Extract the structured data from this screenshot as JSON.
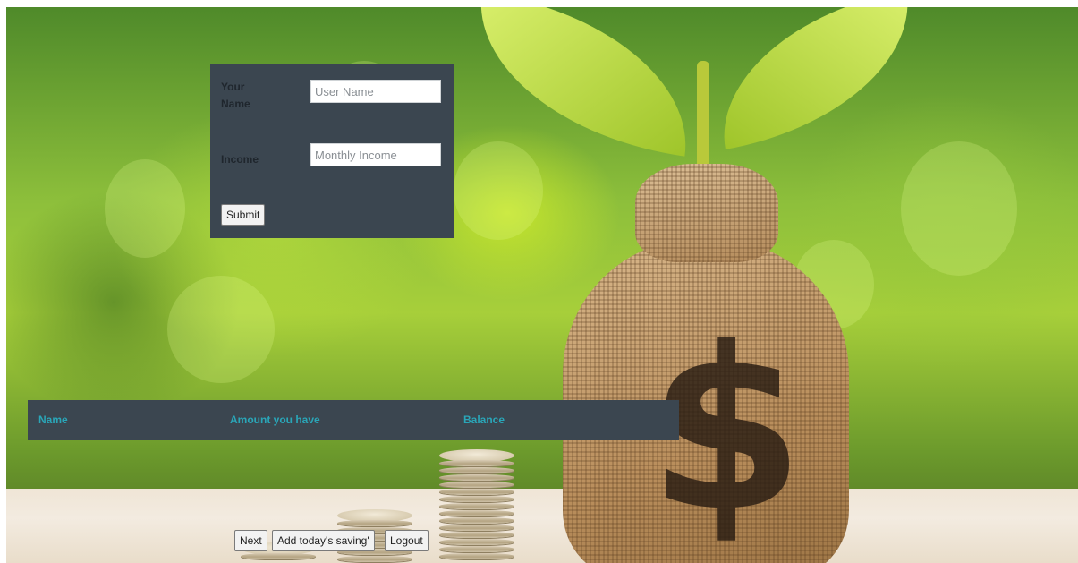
{
  "form": {
    "name_label": "Your Name",
    "name_placeholder": "User Name",
    "income_label": "Income",
    "income_placeholder": "Monthly Income",
    "submit_label": "Submit"
  },
  "table": {
    "columns": [
      "Name",
      "Amount you have",
      "Balance"
    ]
  },
  "actions": {
    "next_label": "Next",
    "add_saving_label": "Add today's saving'",
    "logout_label": "Logout"
  },
  "colors": {
    "panel_bg": "#3b4650",
    "header_text": "#2aa6b8"
  }
}
